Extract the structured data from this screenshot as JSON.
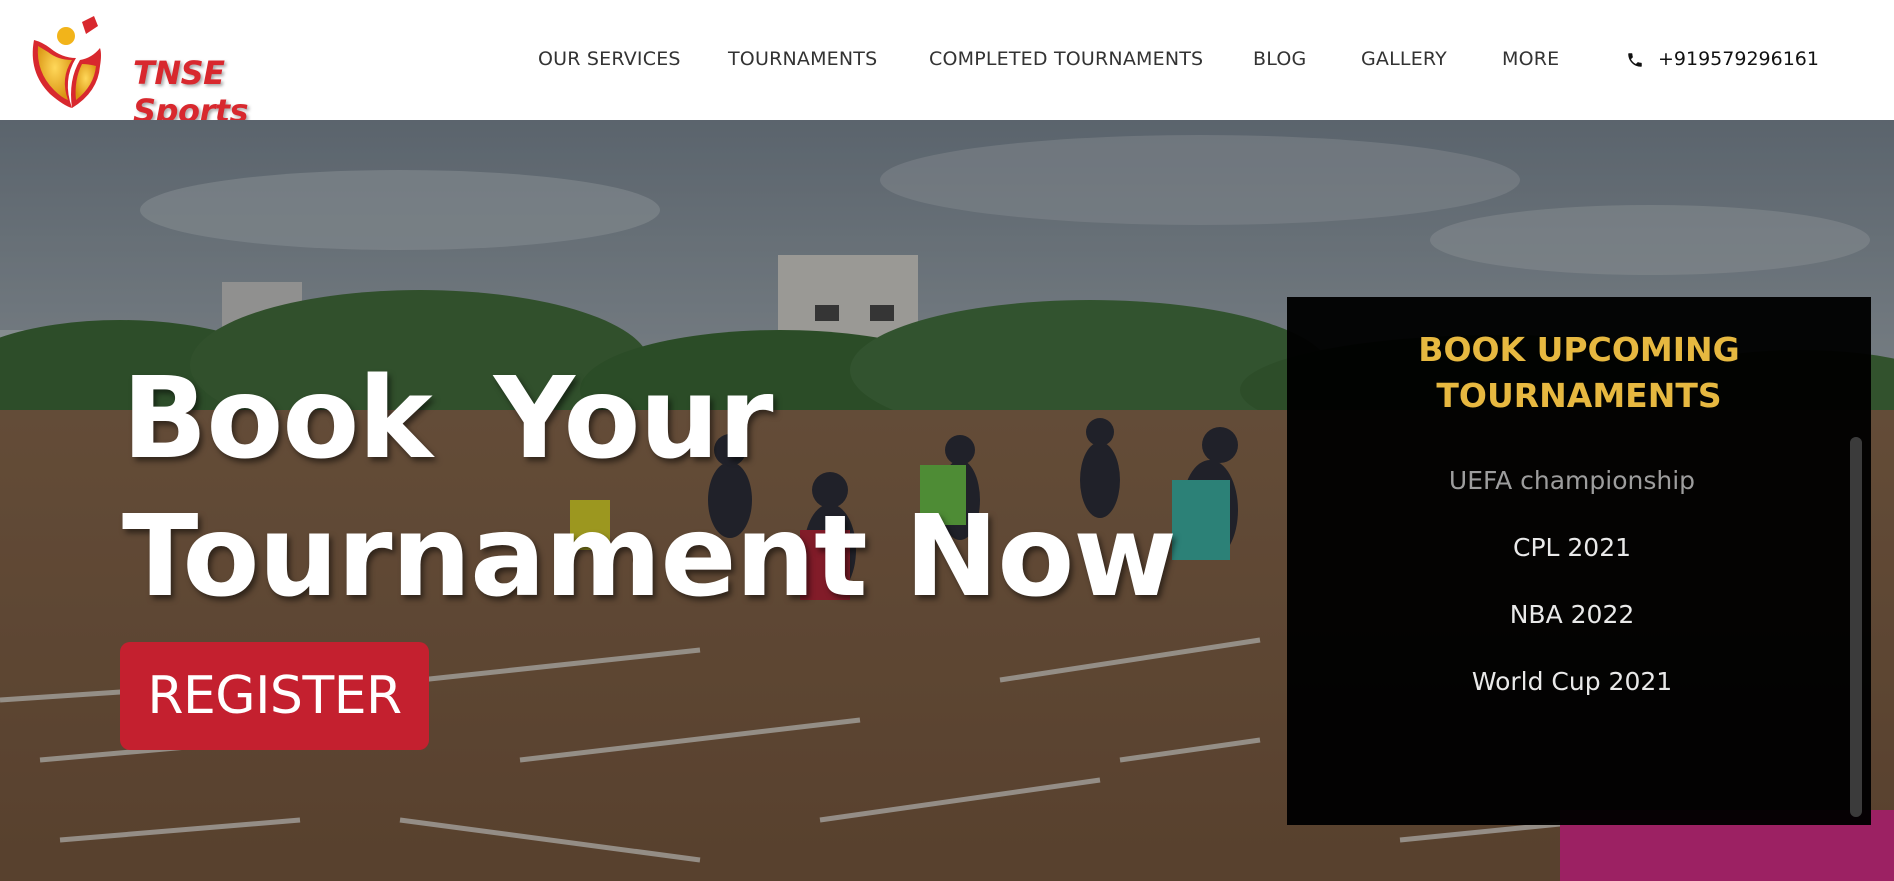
{
  "brand": {
    "name": "TNSE Sports"
  },
  "nav": {
    "items": [
      {
        "label": "OUR SERVICES"
      },
      {
        "label": "TOURNAMENTS"
      },
      {
        "label": "COMPLETED TOURNAMENTS"
      },
      {
        "label": "BLOG"
      },
      {
        "label": "GALLERY"
      },
      {
        "label": "MORE"
      }
    ],
    "phone": {
      "icon": "phone-icon",
      "number": "+919579296161"
    }
  },
  "hero": {
    "title_line1": "Book Your",
    "title_line2": "Tournament Now",
    "register_label": "REGISTER"
  },
  "upcoming": {
    "title_line1": "BOOK UPCOMING",
    "title_line2": "TOURNAMENTS",
    "items": [
      {
        "label": "UEFA championship"
      },
      {
        "label": "CPL 2021"
      },
      {
        "label": "NBA 2022"
      },
      {
        "label": "World Cup 2021"
      }
    ]
  },
  "colors": {
    "accent": "#c4202f",
    "gold": "#e6b840",
    "panel": "#000000"
  }
}
